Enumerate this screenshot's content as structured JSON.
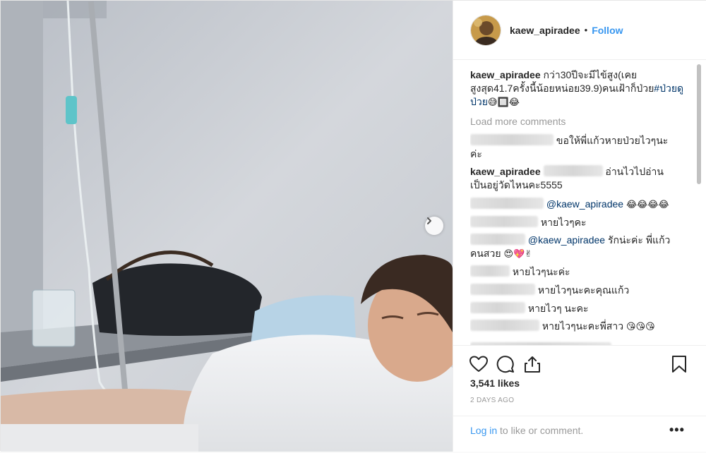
{
  "post": {
    "username": "kaew_apiradee",
    "follow_label": "Follow",
    "separator": "•",
    "caption": {
      "user": "kaew_apiradee",
      "text": "กว่า30ปีจะมีไข้สูง(เคยสูงสุด41.7ครั้งนี้น้อยหน่อย39.9)คนเฝ้าก็ป่วย",
      "hashtag": "#ป่วยดูป่วย",
      "emoji": "😅🔲😂"
    },
    "load_more": "Load more comments",
    "comments": [
      {
        "text": "ขอให้พี่แก้วหายป่วยไวๆนะ",
        "cont": "ค่ะ"
      },
      {
        "user": "kaew_apiradee",
        "text": "อ่านไวไปอ่าน",
        "cont": "เป็นอยู่วัดไหนคะ5555"
      },
      {
        "mention": "@kaew_apiradee",
        "emoji": "😂😂😂😂"
      },
      {
        "text": "หายไวๆคะ"
      },
      {
        "mention": "@kaew_apiradee",
        "text": "รักน่ะค่ะ พี่แก้ว",
        "cont": "คนสวย",
        "emoji": "😍💖✌"
      },
      {
        "text": "หายไวๆนะค่ะ"
      },
      {
        "text": "หายไวๆนะคะคุณแก้ว"
      },
      {
        "text": "หายไวๆ นะคะ"
      },
      {
        "text": "หายไวๆนะคะพี่สาว",
        "emoji": "😘😘😘"
      }
    ],
    "likes": "3,541 likes",
    "time_ago": "2 DAYS AGO",
    "login_link": "Log in",
    "login_rest": " to like or comment.",
    "more_options": "•••"
  },
  "icons": {
    "like": "heart-icon",
    "comment": "comment-icon",
    "share": "share-icon",
    "save": "bookmark-icon",
    "next": "chevron-right-icon"
  },
  "colors": {
    "link": "#3897f0",
    "hashtag": "#003569",
    "muted": "#999999",
    "text": "#262626"
  }
}
